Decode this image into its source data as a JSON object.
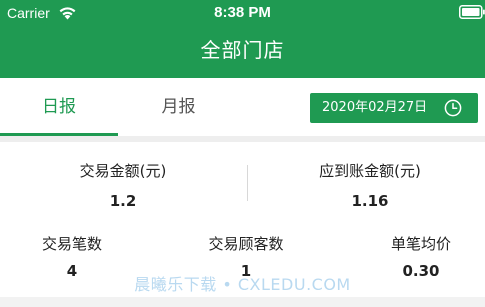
{
  "colors": {
    "brand": "#1f9a52",
    "text": "#222222",
    "muted": "#555555"
  },
  "status_bar": {
    "carrier": "Carrier",
    "time": "8:38 PM",
    "icons": [
      "wifi-icon",
      "battery-icon"
    ]
  },
  "header": {
    "title": "全部门店"
  },
  "tabs": [
    {
      "label": "日报",
      "selected": true
    },
    {
      "label": "月报",
      "selected": false
    }
  ],
  "date_picker": {
    "value": "2020年02月27日",
    "icon": "clock-icon"
  },
  "stats": {
    "trade_amount": {
      "label": "交易金额(元)",
      "value": "1.2"
    },
    "settlement_amount": {
      "label": "应到账金额(元)",
      "value": "1.16"
    },
    "trade_count": {
      "label": "交易笔数",
      "value": "4"
    },
    "customer_count": {
      "label": "交易顾客数",
      "value": "1"
    },
    "avg_per_trade": {
      "label": "单笔均价",
      "value": "0.30"
    }
  },
  "watermark": "晨曦乐下载 • CXLEDU.COM"
}
